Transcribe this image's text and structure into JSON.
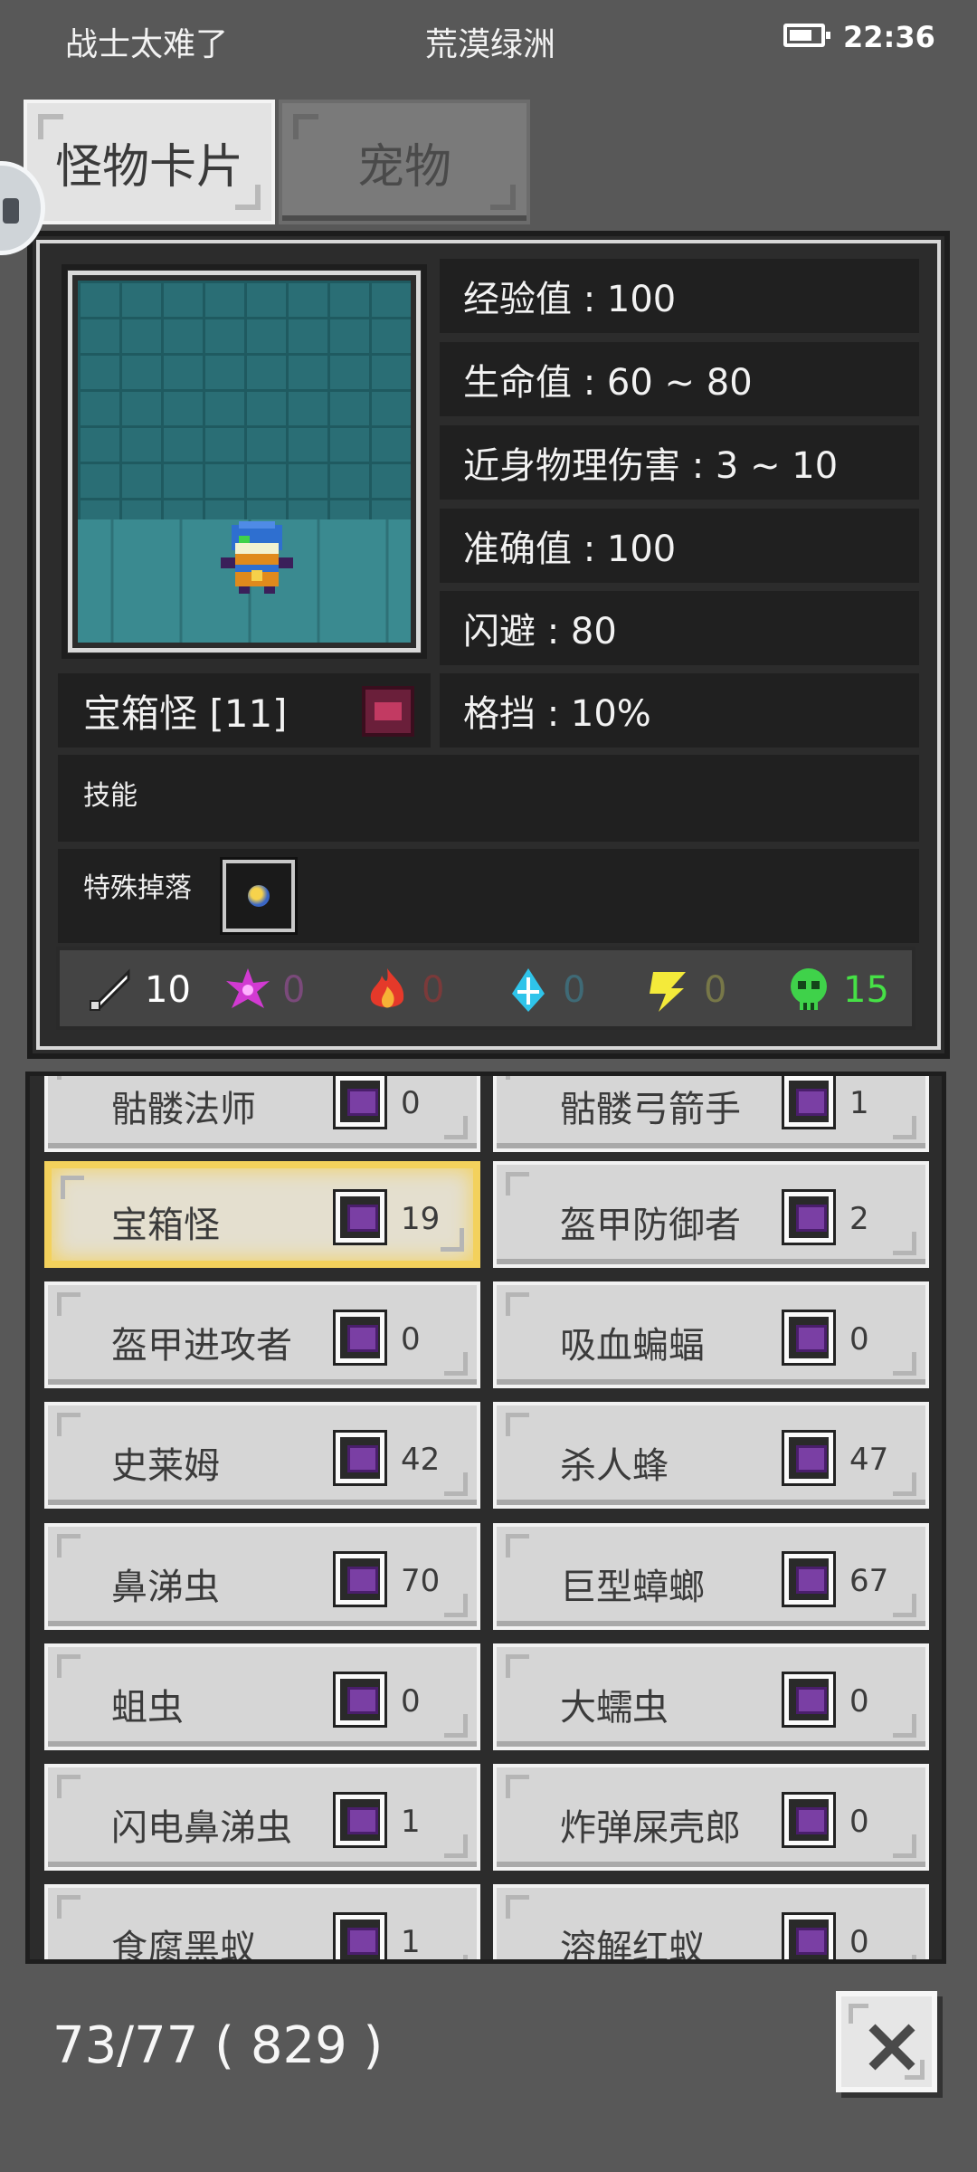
{
  "status_bar": {
    "carrier": "战士太难了",
    "location": "荒漠绿洲",
    "time": "22:36"
  },
  "tabs": [
    {
      "label": "怪物卡片",
      "active": true
    },
    {
      "label": "宠物",
      "active": false
    }
  ],
  "monster": {
    "name": "宝箱怪 [11]",
    "stats": [
      "经验值 : 100",
      "生命值 : 60 ~ 80",
      "近身物理伤害 : 3 ~ 10",
      "准确值 : 100",
      "闪避 : 80",
      "格挡 : 10%"
    ],
    "skills_label": "技能",
    "drops_label": "特殊掉落",
    "resistances": [
      {
        "icon": "physical-icon",
        "value": "10",
        "color": "#ffffff"
      },
      {
        "icon": "arcane-icon",
        "value": "0",
        "color": "#7a4a7a"
      },
      {
        "icon": "fire-icon",
        "value": "0",
        "color": "#7a3a3a"
      },
      {
        "icon": "ice-icon",
        "value": "0",
        "color": "#3f6a76"
      },
      {
        "icon": "lightning-icon",
        "value": "0",
        "color": "#777748"
      },
      {
        "icon": "poison-icon",
        "value": "15",
        "color": "#46e046"
      }
    ]
  },
  "monster_list": [
    {
      "name": "骷髅法师",
      "count": "0"
    },
    {
      "name": "骷髅弓箭手",
      "count": "1"
    },
    {
      "name": "宝箱怪",
      "count": "19",
      "selected": true
    },
    {
      "name": "盔甲防御者",
      "count": "2"
    },
    {
      "name": "盔甲进攻者",
      "count": "0"
    },
    {
      "name": "吸血蝙蝠",
      "count": "0"
    },
    {
      "name": "史莱姆",
      "count": "42"
    },
    {
      "name": "杀人蜂",
      "count": "47"
    },
    {
      "name": "鼻涕虫",
      "count": "70"
    },
    {
      "name": "巨型蟑螂",
      "count": "67"
    },
    {
      "name": "蛆虫",
      "count": "0"
    },
    {
      "name": "大蠕虫",
      "count": "0"
    },
    {
      "name": "闪电鼻涕虫",
      "count": "1"
    },
    {
      "name": "炸弹屎壳郎",
      "count": "0"
    },
    {
      "name": "食腐黑蚁",
      "count": "1"
    },
    {
      "name": "溶解红蚁",
      "count": "0"
    }
  ],
  "footer": {
    "progress": "73/77 ( 829 )"
  }
}
